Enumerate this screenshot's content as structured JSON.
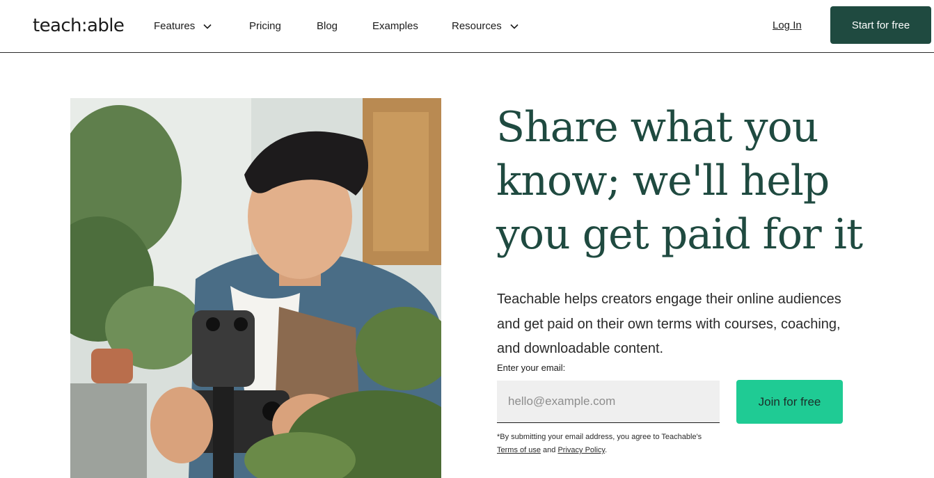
{
  "nav": {
    "logo": "teach:able",
    "items": [
      {
        "label": "Features",
        "has_dropdown": true
      },
      {
        "label": "Pricing",
        "has_dropdown": false
      },
      {
        "label": "Blog",
        "has_dropdown": false
      },
      {
        "label": "Examples",
        "has_dropdown": false
      },
      {
        "label": "Resources",
        "has_dropdown": true
      }
    ],
    "login": "Log In",
    "cta": "Start for free"
  },
  "hero": {
    "image_alt_icon": "photo-man-filming-plants-icon",
    "headline_lines": [
      "Share what you",
      "know; we'll help",
      "you get paid for it"
    ],
    "subtext": "Teachable helps creators engage their online audiences and get paid on their own terms with courses, coaching, and downloadable content.",
    "email_label": "Enter your email:",
    "email_placeholder": "hello@example.com",
    "email_value": "",
    "join_button": "Join for free",
    "legal_prefix": "*By submitting your email address, you agree to Teachable's",
    "terms_link": "Terms of use",
    "legal_and": "and",
    "privacy_link": "Privacy Policy",
    "legal_suffix": "."
  },
  "colors": {
    "brand_dark": "#1f4a40",
    "brand_green": "#1fcb94"
  }
}
